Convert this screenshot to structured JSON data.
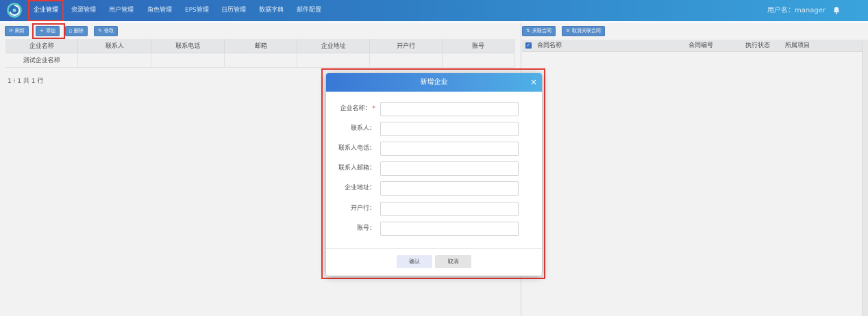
{
  "colors": {
    "nav_bg": "#2f68ba",
    "accent": "#3b78c9",
    "highlight": "#e53935",
    "button": "#5b95d6"
  },
  "nav": {
    "items": [
      {
        "label": "企业管理",
        "active": true
      },
      {
        "label": "资源管理",
        "active": false
      },
      {
        "label": "用户管理",
        "active": false
      },
      {
        "label": "角色管理",
        "active": false
      },
      {
        "label": "EPS管理",
        "active": false
      },
      {
        "label": "日历管理",
        "active": false
      },
      {
        "label": "数据字典",
        "active": false
      },
      {
        "label": "邮件配置",
        "active": false
      }
    ],
    "user_label": "用户名：manager",
    "bell_icon": "bell-icon"
  },
  "left_toolbar": {
    "refresh": {
      "label": "刷新",
      "icon": "refresh-icon"
    },
    "add": {
      "label": "添加",
      "icon": "plus-icon"
    },
    "delete": {
      "label": "删除",
      "icon": "trash-icon"
    },
    "edit": {
      "label": "修改",
      "icon": "edit-icon"
    }
  },
  "left_table": {
    "columns": [
      "企业名称",
      "联系人",
      "联系电话",
      "邮箱",
      "企业地址",
      "开户行",
      "账号"
    ],
    "rows": [
      [
        "测试企业名称",
        "",
        "",
        "",
        "",
        "",
        ""
      ]
    ]
  },
  "pager": {
    "text": "1 ⁝ 1 共 1 行"
  },
  "right_toolbar": {
    "link": {
      "label": "关联合同",
      "icon": "link-icon"
    },
    "unlink": {
      "label": "取消关联合同",
      "icon": "gear-icon"
    }
  },
  "right_table": {
    "columns": [
      "合同名称",
      "合同编号",
      "执行状态",
      "所属项目"
    ]
  },
  "modal": {
    "title": "新增企业",
    "close_icon": "close-icon",
    "fields": [
      {
        "label": "企业名称：",
        "required": true,
        "value": "",
        "placeholder": ""
      },
      {
        "label": "联系人：",
        "required": false,
        "value": "",
        "placeholder": ""
      },
      {
        "label": "联系人电话：",
        "required": false,
        "value": "",
        "placeholder": ""
      },
      {
        "label": "联系人邮箱：",
        "required": false,
        "value": "",
        "placeholder": ""
      },
      {
        "label": "企业地址：",
        "required": false,
        "value": "",
        "placeholder": ""
      },
      {
        "label": "开户行：",
        "required": false,
        "value": "",
        "placeholder": ""
      },
      {
        "label": "账号：",
        "required": false,
        "value": "",
        "placeholder": ""
      }
    ],
    "ok_label": "确认",
    "cancel_label": "取消"
  }
}
